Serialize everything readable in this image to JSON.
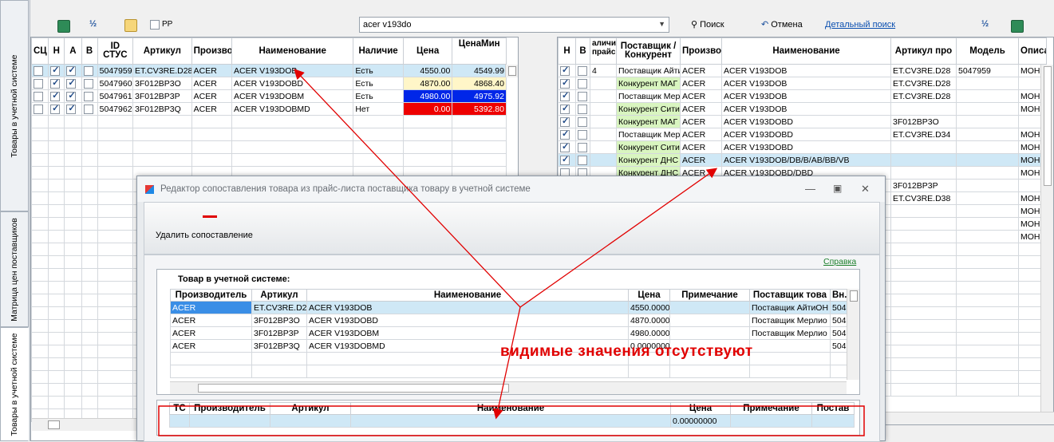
{
  "side_tabs": [
    {
      "label": "Товары в учетной системе"
    },
    {
      "label": "Матрица цен поставщиков"
    },
    {
      "label": "Товары в учетной системе"
    }
  ],
  "left_toolbar": {
    "checkbox_label": "РР"
  },
  "search": {
    "value": "acer v193do",
    "search_label": "Поиск",
    "cancel_label": "Отмена",
    "detail_link": "Детальный поиск"
  },
  "left_grid": {
    "columns": [
      "СЦ",
      "Н",
      "А",
      "В",
      "ID СТУС",
      "Артикул",
      "Произво",
      "Наименование",
      "Наличие",
      "Цена",
      "ЦенаМин"
    ],
    "rows": [
      {
        "sc": false,
        "n": true,
        "a": true,
        "b": false,
        "id": "5047959",
        "art": "ET.CV3RE.D28",
        "mfr": "ACER",
        "name": "ACER V193DOB",
        "avail": "Есть",
        "price": "4550.00",
        "min": "4549.99"
      },
      {
        "sc": false,
        "n": true,
        "a": true,
        "b": false,
        "id": "5047960",
        "art": "3F012BP3O",
        "mfr": "ACER",
        "name": "ACER V193DOBD",
        "avail": "Есть",
        "price": "4870.00",
        "min": "4868.40"
      },
      {
        "sc": false,
        "n": true,
        "a": true,
        "b": false,
        "id": "5047961",
        "art": "3F012BP3P",
        "mfr": "ACER",
        "name": "ACER V193DOBM",
        "avail": "Есть",
        "price": "4980.00",
        "min": "4975.92"
      },
      {
        "sc": false,
        "n": true,
        "a": true,
        "b": false,
        "id": "5047962",
        "art": "3F012BP3Q",
        "mfr": "ACER",
        "name": "ACER V193DOBMD",
        "avail": "Нет",
        "price": "0.00",
        "min": "5392.80"
      }
    ]
  },
  "right_grid": {
    "columns": [
      "Н",
      "В",
      "аличи прайс",
      "Поставщик / Конкурент",
      "Произво",
      "Наименование",
      "Артикул про",
      "Модель",
      "Описа"
    ],
    "rows": [
      {
        "n": true,
        "b": false,
        "cnt": "4",
        "sup": "Поставщик Айти",
        "mfr": "ACER",
        "name": "ACER V193DOB",
        "art": "ET.CV3RE.D28",
        "model": "5047959",
        "desc": "МОНИ"
      },
      {
        "n": true,
        "b": false,
        "cnt": "",
        "sup": "Конкурент МАГ",
        "mfr": "ACER",
        "name": "ACER V193DOB",
        "art": "ET.CV3RE.D28",
        "model": "",
        "desc": ""
      },
      {
        "n": true,
        "b": false,
        "cnt": "",
        "sup": "Поставщик Мер",
        "mfr": "ACER",
        "name": "ACER V193DOB",
        "art": "ET.CV3RE.D28",
        "model": "",
        "desc": "МОНИ"
      },
      {
        "n": true,
        "b": false,
        "cnt": "",
        "sup": "Конкурент Сити",
        "mfr": "ACER",
        "name": "ACER V193DOB",
        "art": "",
        "model": "",
        "desc": "МОНИ"
      },
      {
        "n": true,
        "b": false,
        "cnt": "",
        "sup": "Конкурент МАГ",
        "mfr": "ACER",
        "name": "ACER V193DOBD",
        "art": "3F012BP3O",
        "model": "",
        "desc": ""
      },
      {
        "n": true,
        "b": false,
        "cnt": "",
        "sup": "Поставщик Мер",
        "mfr": "ACER",
        "name": "ACER V193DOBD",
        "art": "ET.CV3RE.D34",
        "model": "",
        "desc": "МОНИ"
      },
      {
        "n": true,
        "b": false,
        "cnt": "",
        "sup": "Конкурент Сити",
        "mfr": "ACER",
        "name": "ACER V193DOBD",
        "art": "",
        "model": "",
        "desc": "МОНИ"
      },
      {
        "n": true,
        "b": false,
        "cnt": "",
        "sup": "Конкурент ДНС",
        "mfr": "ACER",
        "name": "ACER V193DOB/DB/B/AB/BB/VB",
        "art": "",
        "model": "",
        "desc": "МОНИ"
      },
      {
        "n": false,
        "b": false,
        "cnt": "",
        "sup": "Конкурент ДНС",
        "mfr": "ACER",
        "name": "ACER V193DOBD/DBD",
        "art": "",
        "model": "",
        "desc": "МОНИ"
      },
      {
        "n": false,
        "b": false,
        "cnt": "",
        "sup": "",
        "mfr": "",
        "name": "",
        "art": "3F012BP3P",
        "model": "",
        "desc": ""
      },
      {
        "n": false,
        "b": false,
        "cnt": "",
        "sup": "",
        "mfr": "",
        "name": "",
        "art": "ET.CV3RE.D38",
        "model": "",
        "desc": "МОНИ"
      },
      {
        "n": false,
        "b": false,
        "cnt": "",
        "sup": "",
        "mfr": "",
        "name": "",
        "art": "",
        "model": "",
        "desc": "МОНИ"
      },
      {
        "n": false,
        "b": false,
        "cnt": "",
        "sup": "",
        "mfr": "",
        "name": "",
        "art": "",
        "model": "",
        "desc": "МОНИ"
      },
      {
        "n": false,
        "b": false,
        "cnt": "",
        "sup": "",
        "mfr": "",
        "name": "",
        "art": "",
        "model": "",
        "desc": "МОНИ"
      }
    ]
  },
  "dialog": {
    "title": "Редактор сопоставления товара из прайс-листа поставщика товару в учетной системе",
    "delete_label": "Удалить сопоставление",
    "help_link": "Справка",
    "section_title": "Товар в учетной системе:",
    "top_columns": [
      "Производитель",
      "Артикул",
      "Наименование",
      "Цена",
      "Примечание",
      "Поставщик това",
      "Вн."
    ],
    "top_rows": [
      {
        "mfr": "ACER",
        "art": "ET.CV3RE.D28",
        "name": "ACER V193DOB",
        "price": "4550.0000",
        "note": "",
        "sup": "Поставщик АйтиОН",
        "vn": "504"
      },
      {
        "mfr": "ACER",
        "art": "3F012BP3O",
        "name": "ACER V193DOBD",
        "price": "4870.0000",
        "note": "",
        "sup": "Поставщик Мерлио",
        "vn": "504"
      },
      {
        "mfr": "ACER",
        "art": "3F012BP3P",
        "name": "ACER V193DOBM",
        "price": "4980.0000",
        "note": "",
        "sup": "Поставщик Мерлио",
        "vn": "504"
      },
      {
        "mfr": "ACER",
        "art": "3F012BP3Q",
        "name": "ACER V193DOBMD",
        "price": "0.0000000",
        "note": "",
        "sup": "",
        "vn": "504"
      }
    ],
    "bottom_columns": [
      "ТС",
      "Производитель",
      "Артикул",
      "Наименование",
      "Цена",
      "Примечание",
      "Постав"
    ],
    "bottom_row": {
      "price": "0.00000000"
    }
  },
  "annotation": {
    "text": "видимые значения отсутствуют",
    "color": "#e10000"
  }
}
